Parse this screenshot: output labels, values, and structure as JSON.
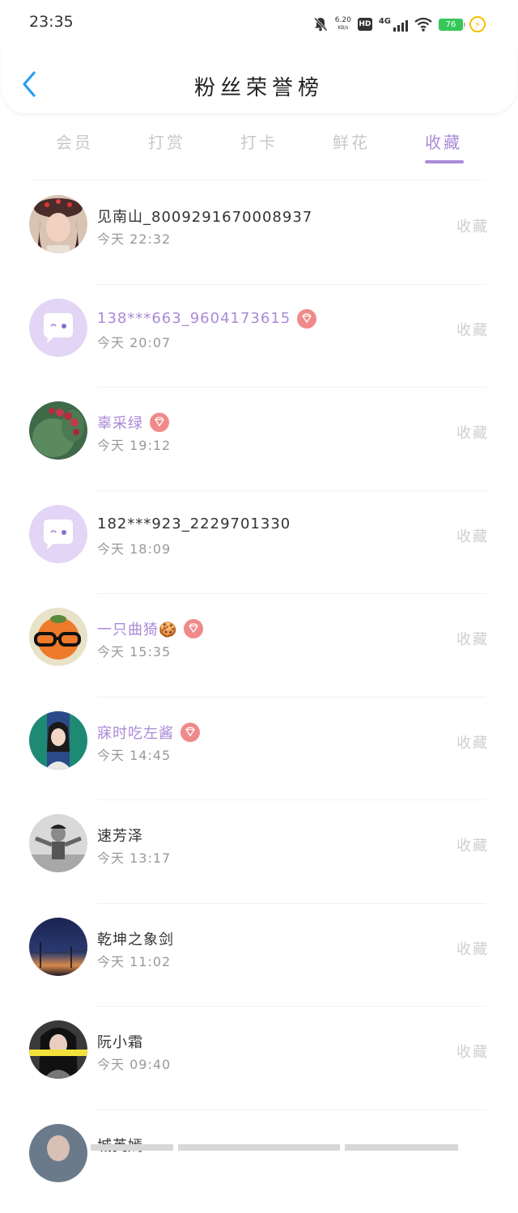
{
  "status_bar": {
    "time": "23:35",
    "net_speed_value": "6.20",
    "net_speed_unit": "KB/s",
    "hd_label": "HD",
    "network_label": "4G",
    "battery_level": "76",
    "icons": [
      "bell-off-icon",
      "hd-icon",
      "signal-icon",
      "wifi-icon",
      "battery-icon",
      "charging-icon"
    ]
  },
  "header": {
    "title": "粉丝荣誉榜",
    "back_icon": "chevron-left-icon"
  },
  "tabs": [
    {
      "label": "会员",
      "active": false
    },
    {
      "label": "打赏",
      "active": false
    },
    {
      "label": "打卡",
      "active": false
    },
    {
      "label": "鲜花",
      "active": false
    },
    {
      "label": "收藏",
      "active": true
    }
  ],
  "colors": {
    "accent": "#a98bd6",
    "vip_name": "#a88ad8",
    "vip_badge": "#f08a8a",
    "inactive_tab": "#c8c8c8",
    "timestamp": "#999999",
    "action_label": "#cfcfcf"
  },
  "fans": [
    {
      "name": "见南山_8009291670008937",
      "time": "今天 22:32",
      "action": "收藏",
      "vip": false,
      "avatar": "photo-girl-red-hat"
    },
    {
      "name": "138***663_9604173615",
      "time": "今天 20:07",
      "action": "收藏",
      "vip": true,
      "avatar": "default-chat-bubble"
    },
    {
      "name": "辜采绿",
      "time": "今天 19:12",
      "action": "收藏",
      "vip": true,
      "avatar": "photo-cactus-fruit"
    },
    {
      "name": "182***923_2229701330",
      "time": "今天 18:09",
      "action": "收藏",
      "vip": false,
      "avatar": "default-chat-bubble"
    },
    {
      "name": "一只曲猗🍪",
      "time": "今天 15:35",
      "action": "收藏",
      "vip": true,
      "avatar": "photo-orange-glasses"
    },
    {
      "name": "寐时吃左酱",
      "time": "今天 14:45",
      "action": "收藏",
      "vip": true,
      "avatar": "photo-girl-green-wall"
    },
    {
      "name": "速芳泽",
      "time": "今天 13:17",
      "action": "收藏",
      "vip": false,
      "avatar": "photo-man-grayscale"
    },
    {
      "name": "乾坤之象剑",
      "time": "今天 11:02",
      "action": "收藏",
      "vip": false,
      "avatar": "photo-dusk-sky"
    },
    {
      "name": "阮小霜",
      "time": "今天 09:40",
      "action": "收藏",
      "vip": false,
      "avatar": "photo-girl-caption"
    },
    {
      "name": "城英嫣",
      "time": "",
      "action": "",
      "vip": false,
      "avatar": "photo-partial"
    }
  ]
}
